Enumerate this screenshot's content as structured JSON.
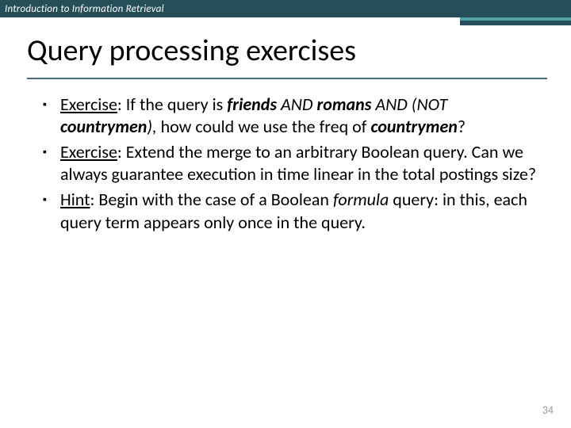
{
  "header": {
    "course": "Introduction to Information Retrieval"
  },
  "title": "Query processing exercises",
  "bullets": [
    {
      "lead": "Exercise",
      "body_html": "If the query is <b><i>friends</i></b> <i>AND</i> <b><i>romans</i></b> <i>AND (NOT</i> <b><i>countrymen</i></b><i>),</i> how could we use the freq of <b><i>countrymen</i></b>?"
    },
    {
      "lead": "Exercise",
      "body_html": "Extend the merge to an arbitrary Boolean query.  Can we always guarantee execution in time linear in the total postings size?"
    },
    {
      "lead": "Hint",
      "body_html": "Begin with the case of a Boolean <i>formula</i> query: in this, each query term appears only once in the query."
    }
  ],
  "page_number": "34"
}
